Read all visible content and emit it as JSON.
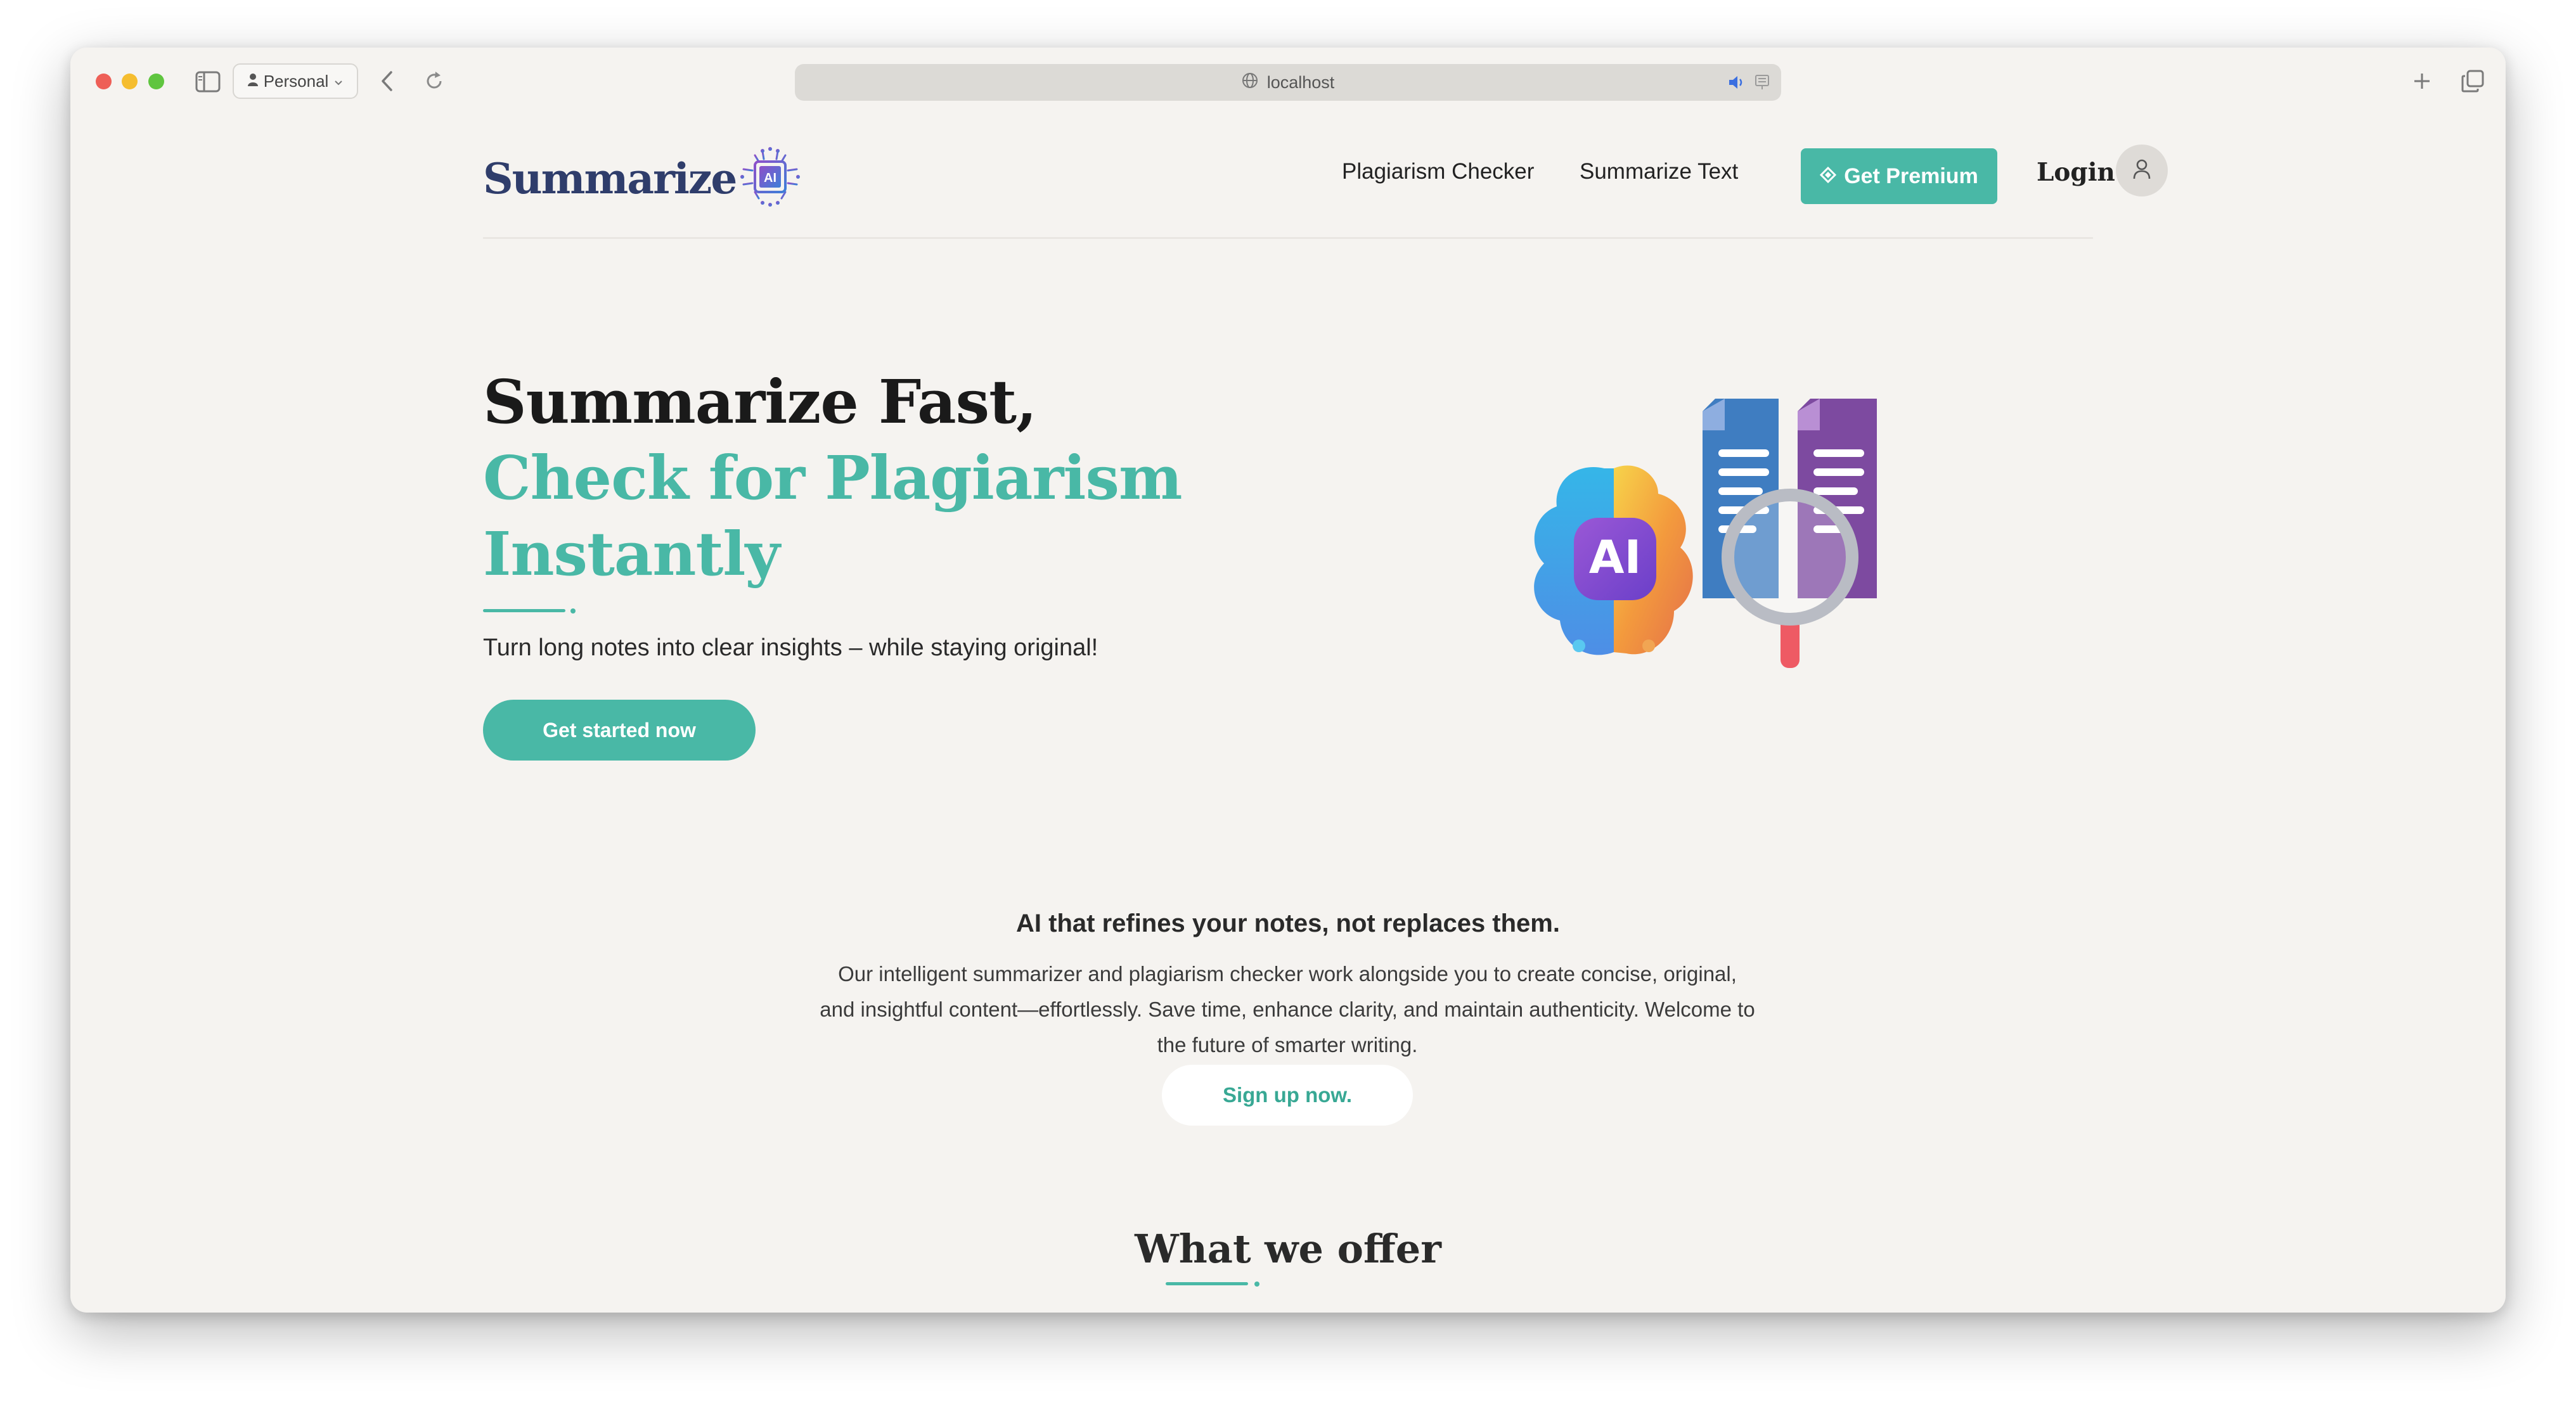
{
  "browser": {
    "profile_label": "Personal",
    "url": "localhost"
  },
  "site": {
    "logo_text": "Summarize",
    "logo_badge": "AI",
    "nav": {
      "plagiarism_checker": "Plagiarism Checker",
      "summarize_text": "Summarize Text"
    },
    "premium_label": "Get Premium",
    "login_label": "Login"
  },
  "hero": {
    "title_line1": "Summarize Fast,",
    "title_line2": "Check for Plagiarism",
    "title_line3": "Instantly",
    "subtitle": "Turn long notes into clear insights – while staying original!",
    "cta_label": "Get started now",
    "illustration_badge": "AI"
  },
  "intro": {
    "heading": "AI that refines your notes, not replaces them.",
    "body": "Our intelligent summarizer and plagiarism checker work alongside you to create concise, original, and insightful content—effortlessly. Save time, enhance clarity, and maintain authenticity. Welcome to the future of smarter writing.",
    "signup_label": "Sign up now."
  },
  "offer": {
    "heading": "What we offer"
  },
  "colors": {
    "accent": "#49b8a6",
    "page_bg": "#f5f3f0",
    "logo_navy": "#2f3d6b"
  }
}
